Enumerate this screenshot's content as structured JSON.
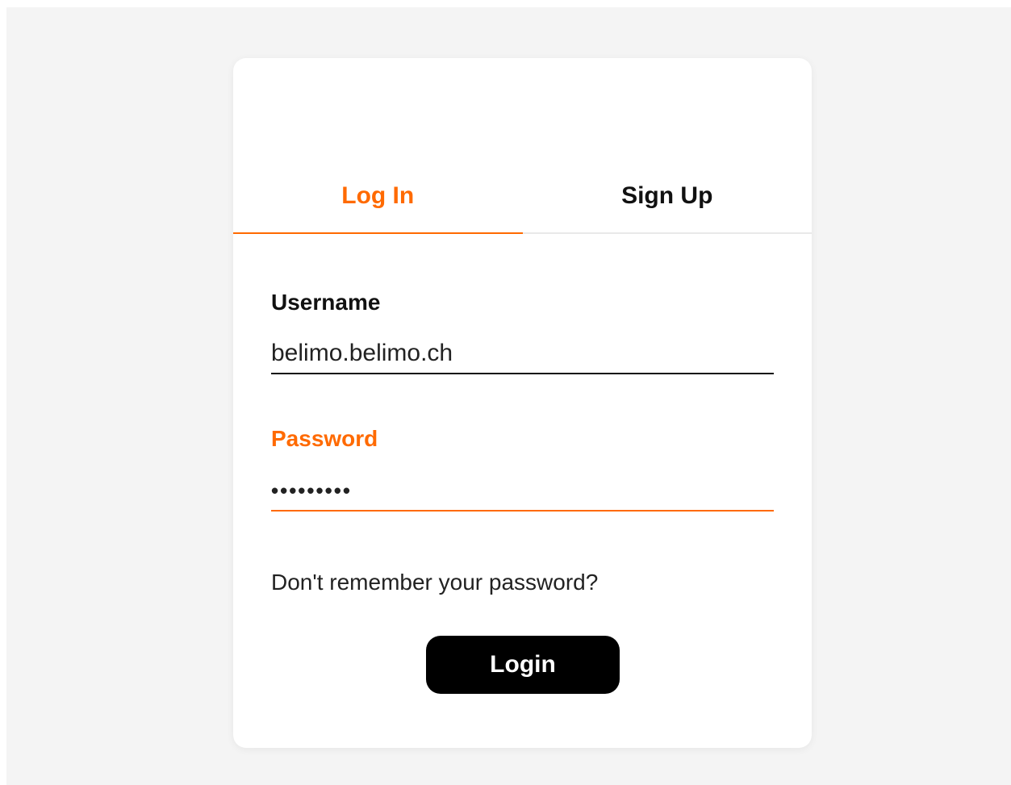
{
  "tabs": {
    "login_label": "Log In",
    "signup_label": "Sign Up",
    "active": "login"
  },
  "form": {
    "username_label": "Username",
    "username_value": "belimo.belimo.ch",
    "password_label": "Password",
    "password_value": "•••••••••",
    "forgot_text": "Don't remember your password?",
    "submit_label": "Login"
  },
  "colors": {
    "accent": "#ff6a00",
    "background": "#f4f4f4",
    "card": "#ffffff",
    "button": "#000000"
  }
}
